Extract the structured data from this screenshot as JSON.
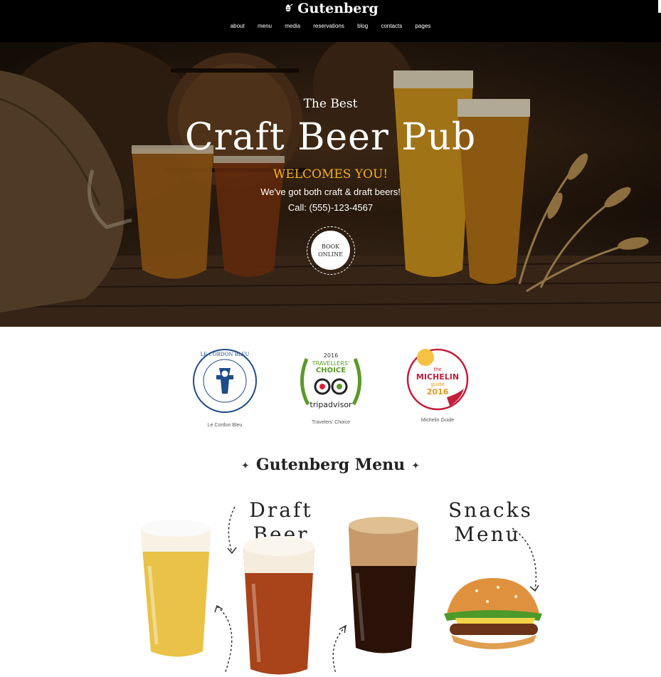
{
  "header": {
    "logo_text": "Gutenberg",
    "logo_icon": "hop-icon",
    "nav": [
      "about",
      "menu",
      "media",
      "reservations",
      "blog",
      "contacts",
      "pages"
    ]
  },
  "hero": {
    "kicker": "The Best",
    "title": "Craft Beer Pub",
    "welcome": "WELCOMES YOU!",
    "subtitle": "We've got both craft & draft beers!",
    "phone": "Call: (555)-123-4567",
    "book_button": "BOOK ONLINE",
    "accent_color": "#f2b21a"
  },
  "awards": [
    {
      "caption": "Le Cordon Bleu",
      "logo_text": "LE CORDON BLEU"
    },
    {
      "caption": "Travelers' Choice",
      "year": "2016",
      "line1": "TRAVELLERS'",
      "line2": "CHOICE",
      "brand": "tripadvisor"
    },
    {
      "caption": "Michelin Guide",
      "the": "the",
      "brand": "MICHELIN",
      "guide": "guide",
      "year": "2016"
    }
  ],
  "menu": {
    "title": "Gutenberg Menu",
    "draft_label": "Draft Beer",
    "snacks_label_1": "Snacks",
    "snacks_label_2": "Menu"
  }
}
